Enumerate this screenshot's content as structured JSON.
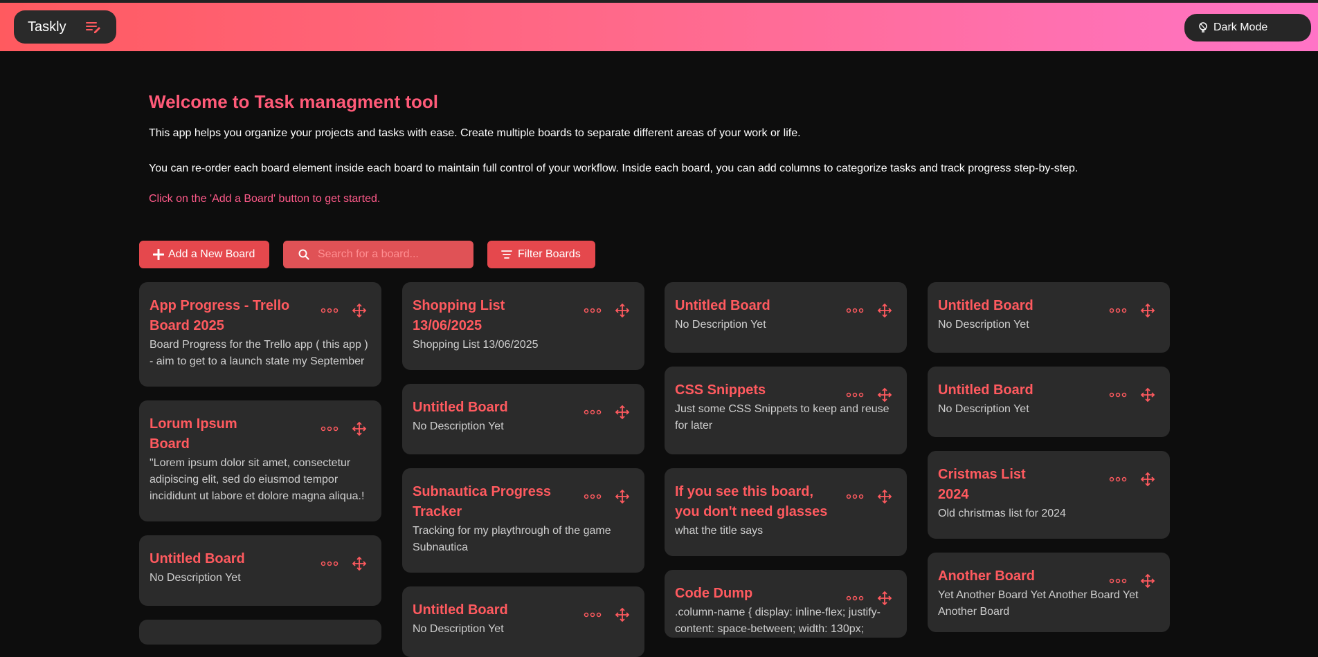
{
  "header": {
    "brand": "Taskly",
    "dark_mode_label": "Dark Mode"
  },
  "intro": {
    "title": "Welcome to Task managment tool",
    "p1": "This app helps you organize your projects and tasks with ease. Create multiple boards to separate different areas of your work or life.",
    "p2": "You can re-order each board element inside each board to maintain full control of your workflow. Inside each board, you can add columns to categorize tasks and track progress step-by-step.",
    "cta": "Click on the 'Add a Board' button to get started."
  },
  "toolbar": {
    "add_label": "Add a New Board",
    "search_placeholder": "Search for a board...",
    "filter_label": "Filter Boards"
  },
  "colors": {
    "accent": "#e5484d",
    "title": "#ff5a5f",
    "card_bg": "#2b2b2b"
  },
  "columns": [
    {
      "boards": [
        {
          "title": "App Progress - Trello Board 2025",
          "desc": "Board Progress for the Trello app ( this app ) - aim to get to a launch state my September"
        },
        {
          "title": "Lorum Ipsum Board",
          "desc": "\"Lorem ipsum dolor sit amet, consectetur adipiscing elit, sed do eiusmod tempor incididunt ut labore et dolore magna aliqua.!"
        },
        {
          "title": "Untitled Board",
          "desc": "No Description Yet"
        }
      ]
    },
    {
      "boards": [
        {
          "title": "Shopping List 13/06/2025",
          "desc": "Shopping List 13/06/2025"
        },
        {
          "title": "Untitled Board",
          "desc": "No Description Yet"
        },
        {
          "title": "Subnautica Progress Tracker",
          "desc": "Tracking for my playthrough of the game Subnautica"
        },
        {
          "title": "Untitled Board",
          "desc": "No Description Yet"
        }
      ]
    },
    {
      "boards": [
        {
          "title": "Untitled Board",
          "desc": "No Description Yet"
        },
        {
          "title": "CSS Snippets",
          "desc": "Just some CSS Snippets to keep and reuse for later"
        },
        {
          "title": "If you see this board, you don't need glasses",
          "desc": "what the title says"
        },
        {
          "title": "Code Dump",
          "desc": ".column-name { display: inline-flex; justify-content: space-between; width: 130px;"
        }
      ]
    },
    {
      "boards": [
        {
          "title": "Untitled Board",
          "desc": "No Description Yet"
        },
        {
          "title": "Untitled Board",
          "desc": "No Description Yet"
        },
        {
          "title": "Cristmas List 2024",
          "desc": "Old christmas list for 2024"
        },
        {
          "title": "Another Board",
          "desc": "Yet Another Board Yet Another Board Yet Another Board"
        }
      ]
    }
  ]
}
